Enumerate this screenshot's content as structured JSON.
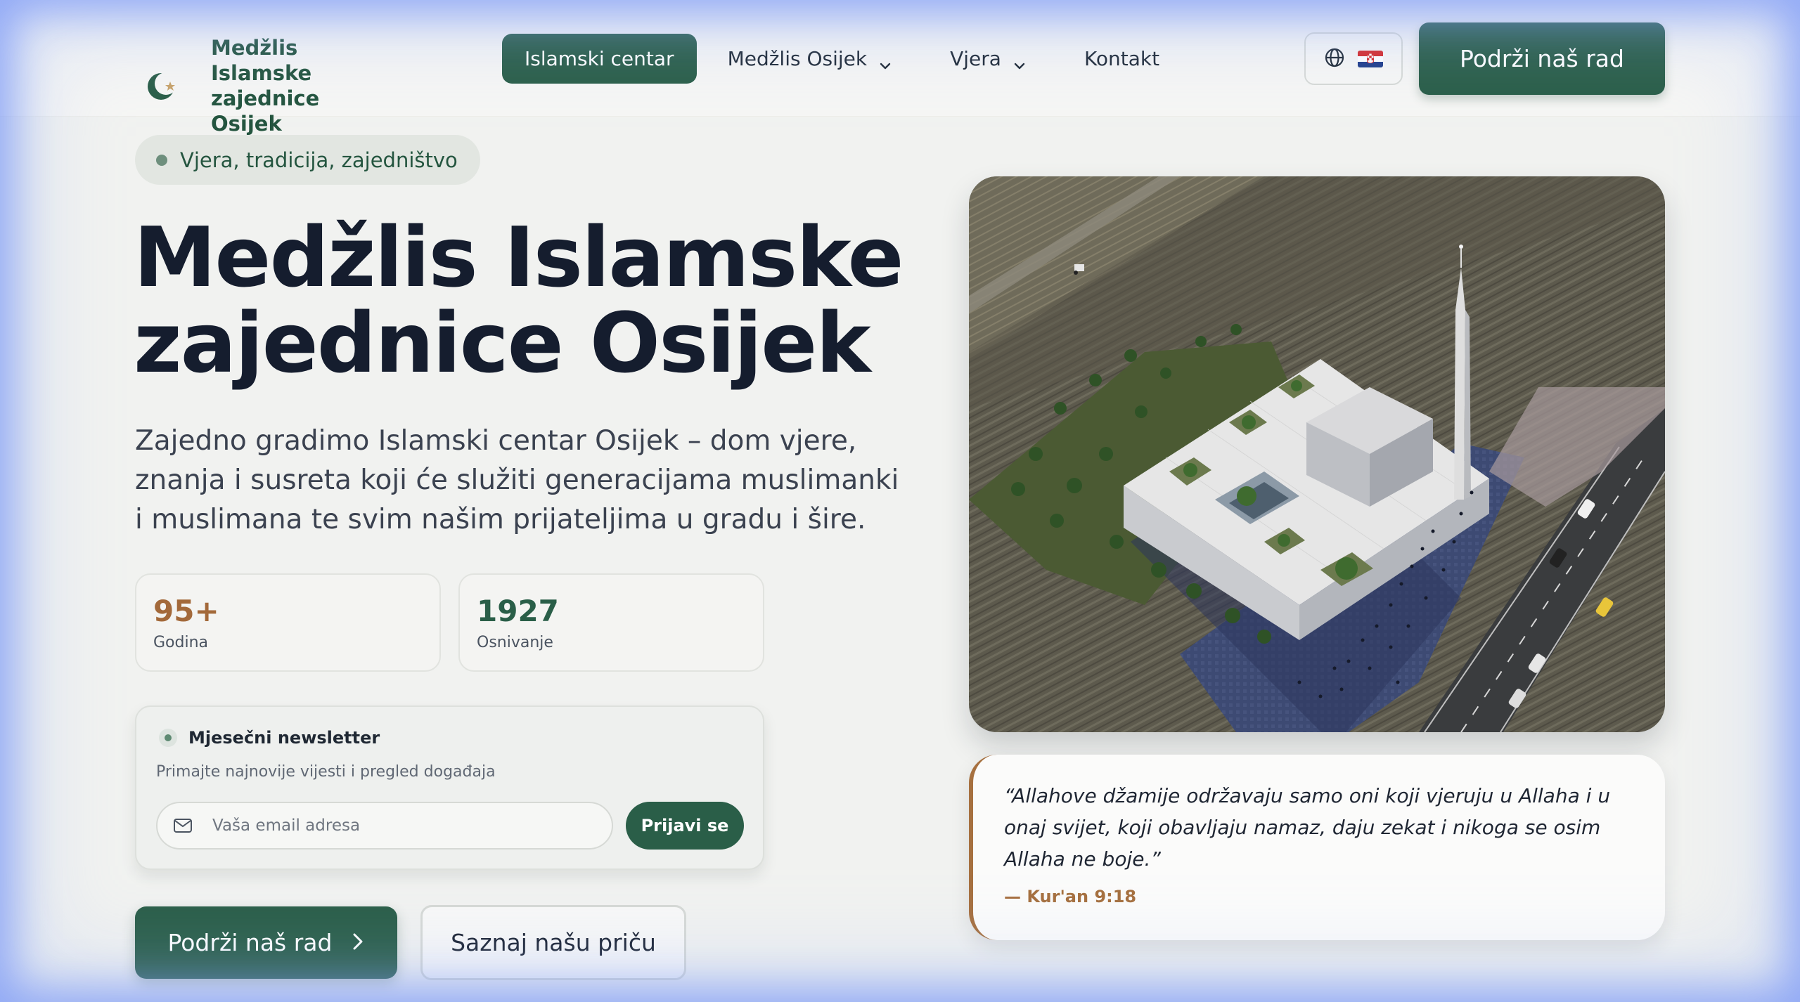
{
  "brand": {
    "name": "Medžlis Islamske zajednice Osijek"
  },
  "nav": {
    "items": [
      {
        "label": "Islamski centar",
        "active": true,
        "dropdown": false
      },
      {
        "label": "Medžlis Osijek",
        "active": false,
        "dropdown": true
      },
      {
        "label": "Vjera",
        "active": false,
        "dropdown": true
      },
      {
        "label": "Kontakt",
        "active": false,
        "dropdown": false
      }
    ],
    "cta_label": "Podrži naš rad"
  },
  "hero": {
    "tagline": "Vjera, tradicija, zajedništvo",
    "title_line1": "Medžlis Islamske",
    "title_line2": "zajednice Osijek",
    "subtitle": "Zajedno gradimo Islamski centar Osijek – dom vjere, znanja i susreta koji će služiti generacijama muslimanki i muslimana te svim našim prijateljima u gradu i šire.",
    "stats": [
      {
        "value": "95+",
        "label": "Godina"
      },
      {
        "value": "1927",
        "label": "Osnivanje"
      }
    ],
    "newsletter": {
      "title": "Mjesečni newsletter",
      "description": "Primajte najnovije vijesti i pregled događaja",
      "placeholder": "Vaša email adresa",
      "button_label": "Prijavi se"
    },
    "primary_cta": "Podrži naš rad",
    "secondary_cta": "Saznaj našu priču"
  },
  "quote": {
    "text": "“Allahove džamije održavaju samo oni koji vjeruju u Allaha i u onaj svijet, koji obavljaju namaz, daju zekat i nikoga se osim Allaha ne boje.”",
    "source": "— Kur'an 9:18"
  },
  "colors": {
    "primary": "#2a5e48",
    "accent": "#a6703f",
    "background": "#f1f2f0",
    "heading": "#151d2e"
  },
  "icons": [
    "crescent-logo-icon",
    "chevron-down-icon",
    "globe-icon",
    "croatian-flag-icon",
    "mail-icon",
    "chevron-right-icon"
  ]
}
